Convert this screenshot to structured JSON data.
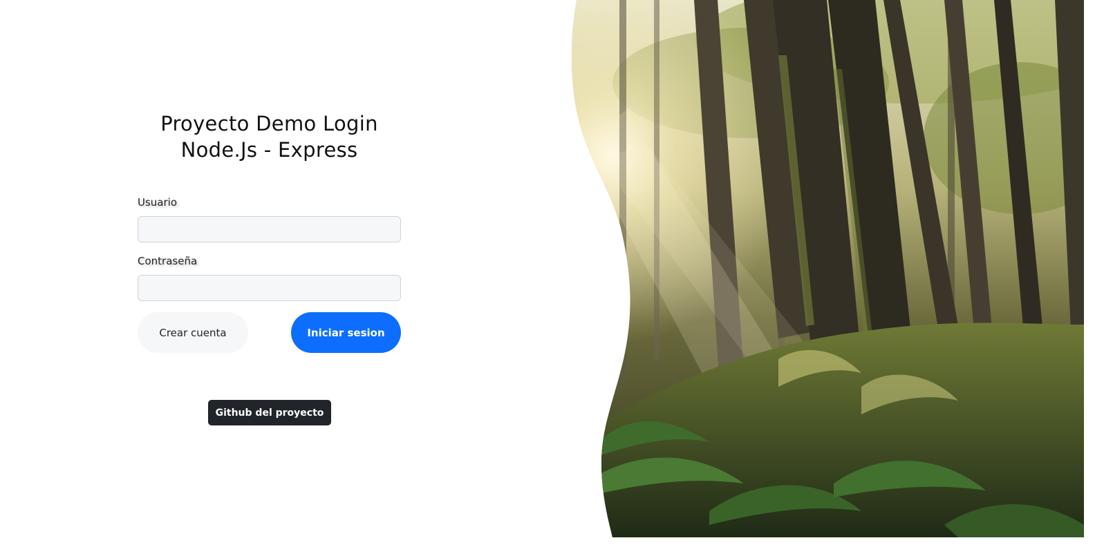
{
  "login": {
    "title_line1": "Proyecto Demo Login",
    "title_line2": "Node.Js - Express",
    "username_label": "Usuario",
    "username_value": "",
    "password_label": "Contraseña",
    "password_value": "",
    "create_account_label": "Crear cuenta",
    "sign_in_label": "Iniciar sesion",
    "github_label": "Github del proyecto"
  },
  "colors": {
    "primary": "#0d6efd",
    "dark": "#212529",
    "light": "#f6f7f9"
  },
  "hero_image": {
    "icon": "forest-photo"
  }
}
